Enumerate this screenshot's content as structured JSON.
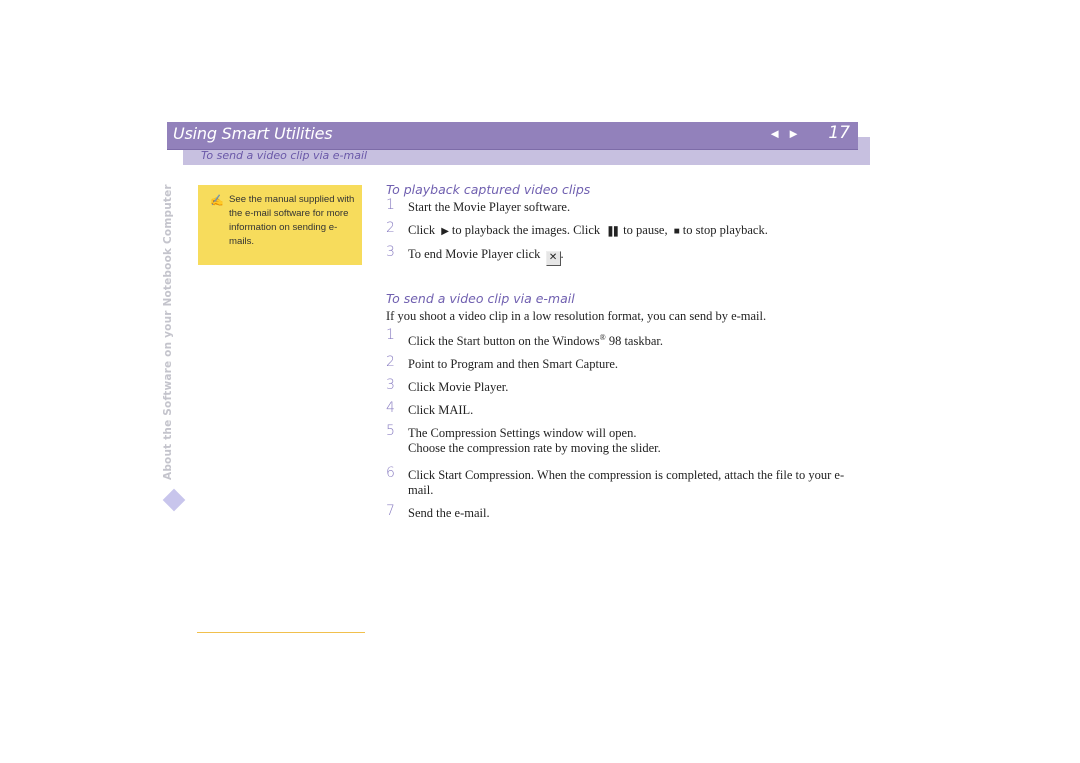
{
  "header": {
    "title": "Using Smart Utilities",
    "prev_icon": "◄",
    "next_icon": "►",
    "page_number": "17",
    "subtitle": "To send a video clip via e-mail"
  },
  "sidebar": {
    "vertical_text": "About the Software on your Notebook Computer",
    "diamond_icon": "diamond-icon"
  },
  "note": {
    "icon": "✍",
    "text": "See the manual supplied with the e-mail software for more information on sending e-mails."
  },
  "sections": {
    "playback": {
      "heading": "To playback captured video clips",
      "steps": [
        {
          "num": "1",
          "text": "Start the Movie Player software."
        },
        {
          "num": "2",
          "pre": "Click",
          "play_icon": "▶",
          "mid1": "to playback the images. Click",
          "pause_icon": "❚❚",
          "mid2": "to pause,",
          "stop_icon": "■",
          "post": "to stop playback."
        },
        {
          "num": "3",
          "pre": "To end Movie Player click",
          "close_icon": "✕",
          "post": "."
        }
      ]
    },
    "email": {
      "heading": "To send a video clip via e-mail",
      "intro": "If you shoot a video clip in a low resolution format, you can send by e-mail.",
      "steps": [
        {
          "num": "1",
          "pre": "Click the Start button on the Windows",
          "sup": "®",
          "post": " 98 taskbar."
        },
        {
          "num": "2",
          "text": "Point to Program and then Smart Capture."
        },
        {
          "num": "3",
          "text": "Click Movie Player."
        },
        {
          "num": "4",
          "text": "Click MAIL."
        },
        {
          "num": "5",
          "text": "The Compression Settings window will open.",
          "text2": "Choose the compression rate by moving the slider."
        },
        {
          "num": "6",
          "text": "Click Start Compression. When the compression is completed, attach the file to your e-mail."
        },
        {
          "num": "7",
          "text": "Send the e-mail."
        }
      ]
    }
  },
  "colors": {
    "header_bar": "#9281bb",
    "sub_bar": "#c7c0e0",
    "heading_text": "#7060b0",
    "note_bg": "#f7dc5c",
    "footer_line": "#f1c04d"
  }
}
